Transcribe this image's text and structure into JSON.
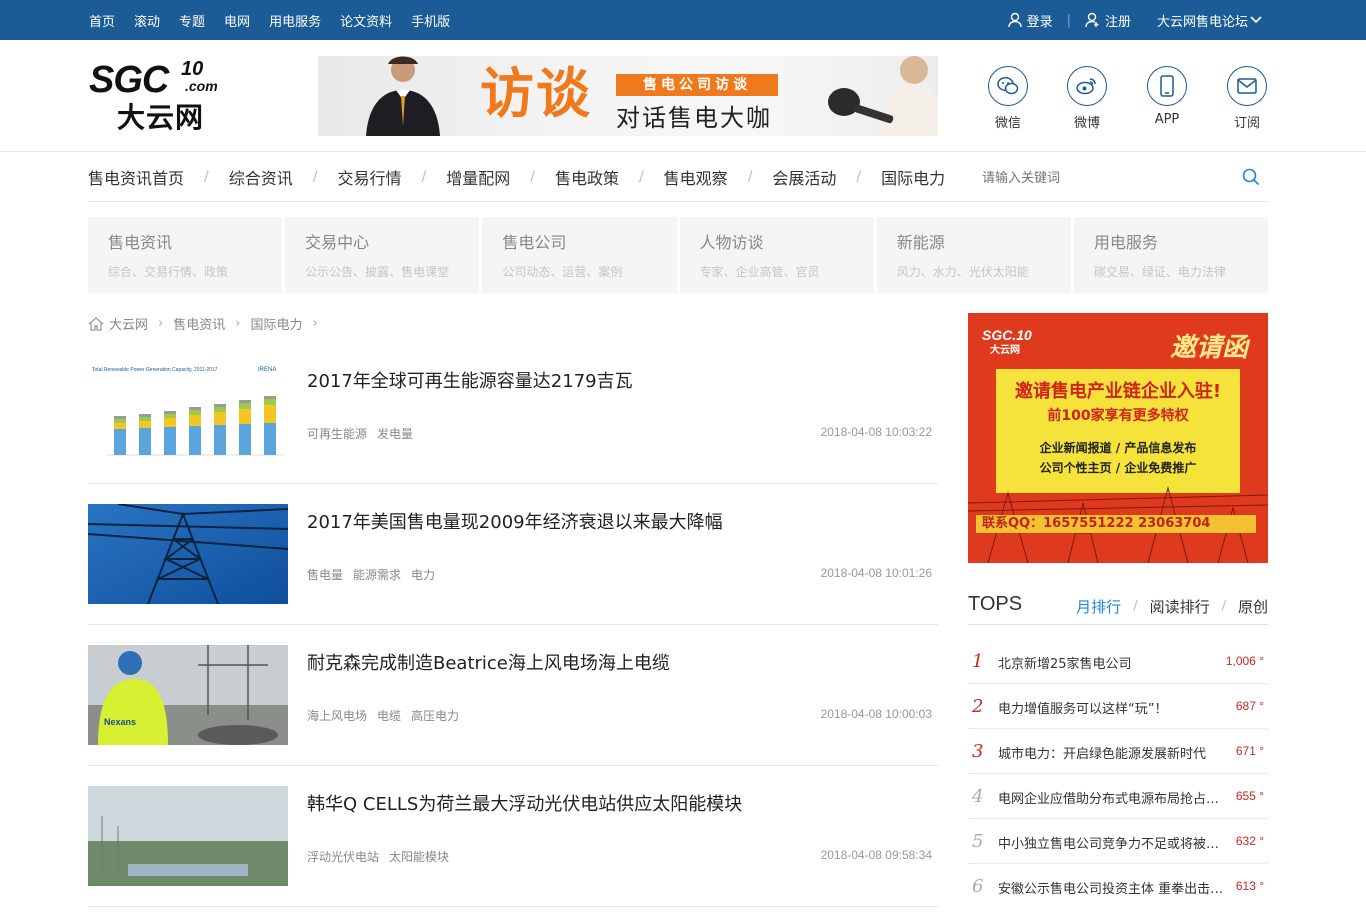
{
  "topbar": {
    "nav": [
      "首页",
      "滚动",
      "专题",
      "电网",
      "用电服务",
      "论文资料",
      "手机版"
    ],
    "login": "登录",
    "register": "注册",
    "forum": "大云网售电论坛"
  },
  "header": {
    "logo_main": "SGC",
    "logo_sup": "10",
    "logo_com": ".com",
    "logo_cn": "大云网",
    "banner_big": "访谈",
    "banner_tag": "售电公司访谈",
    "banner_sub": "对话售电大咖",
    "social": [
      {
        "label": "微信",
        "icon": "wechat-icon"
      },
      {
        "label": "微博",
        "icon": "weibo-icon"
      },
      {
        "label": "APP",
        "icon": "phone-icon"
      },
      {
        "label": "订阅",
        "icon": "mail-icon"
      }
    ]
  },
  "mainnav": {
    "items": [
      "售电资讯首页",
      "综合资讯",
      "交易行情",
      "增量配网",
      "售电政策",
      "售电观察",
      "会展活动",
      "国际电力"
    ],
    "search_placeholder": "请输入关键词"
  },
  "categories": [
    {
      "title": "售电资讯",
      "sub": "综合、交易行情、政策"
    },
    {
      "title": "交易中心",
      "sub": "公示公告、披露、售电课堂"
    },
    {
      "title": "售电公司",
      "sub": "公司动态、运营、案例"
    },
    {
      "title": "人物访谈",
      "sub": "专家、企业高管、官员"
    },
    {
      "title": "新能源",
      "sub": "风力、水力、光伏太阳能"
    },
    {
      "title": "用电服务",
      "sub": "碳交易、绿证、电力法律"
    }
  ],
  "breadcrumb": [
    "大云网",
    "售电资讯",
    "国际电力"
  ],
  "articles": [
    {
      "title": "2017年全球可再生能源容量达2179吉瓦",
      "tags": [
        "可再生能源",
        "发电量"
      ],
      "time": "2018-04-08 10:03:22",
      "thumb_caption": "Total Renewable Power Generation Capacity, 2011-2017",
      "thumb_brand": "IRENA"
    },
    {
      "title": "2017年美国售电量现2009年经济衰退以来最大降幅",
      "tags": [
        "售电量",
        "能源需求",
        "电力"
      ],
      "time": "2018-04-08 10:01:26"
    },
    {
      "title": "耐克森完成制造Beatrice海上风电场海上电缆",
      "tags": [
        "海上风电场",
        "电缆",
        "高压电力"
      ],
      "time": "2018-04-08 10:00:03",
      "thumb_brand": "Nexans"
    },
    {
      "title": "韩华Q CELLS为荷兰最大浮动光伏电站供应太阳能模块",
      "tags": [
        "浮动光伏电站",
        "太阳能模块"
      ],
      "time": "2018-04-08 09:58:34"
    }
  ],
  "ad": {
    "logo": "SGC.10",
    "logo_cn": "大云网",
    "invite": "邀请函",
    "line1": "邀请售电产业链企业入驻!",
    "line2": "前100家享有更多特权",
    "line3": "企业新闻报道 / 产品信息发布",
    "line4": "公司个性主页 / 企业免费推广",
    "qq": "联系QQ：1657551222   23063704"
  },
  "tops": {
    "title": "TOPS",
    "tabs": [
      "月排行",
      "阅读排行",
      "原创"
    ],
    "items": [
      {
        "no": "1",
        "text": "北京新增25家售电公司",
        "count": "1,006 °"
      },
      {
        "no": "2",
        "text": "电力增值服务可以这样“玩”！",
        "count": "687 °"
      },
      {
        "no": "3",
        "text": "城市电力：开启绿色能源发展新时代",
        "count": "671 °"
      },
      {
        "no": "4",
        "text": "电网企业应借助分布式电源布局抢占市场",
        "count": "655 °"
      },
      {
        "no": "5",
        "text": "中小独立售电公司竞争力不足或将被淘汰",
        "count": "632 °"
      },
      {
        "no": "6",
        "text": "安徽公示售电公司投资主体 重拳出击规范市场",
        "count": "613 °"
      }
    ]
  },
  "colors": {
    "topbar": "#1b5c96",
    "accent_orange": "#f07a1b",
    "rank_red": "#c9281e",
    "tab_active": "#1b87d2"
  }
}
